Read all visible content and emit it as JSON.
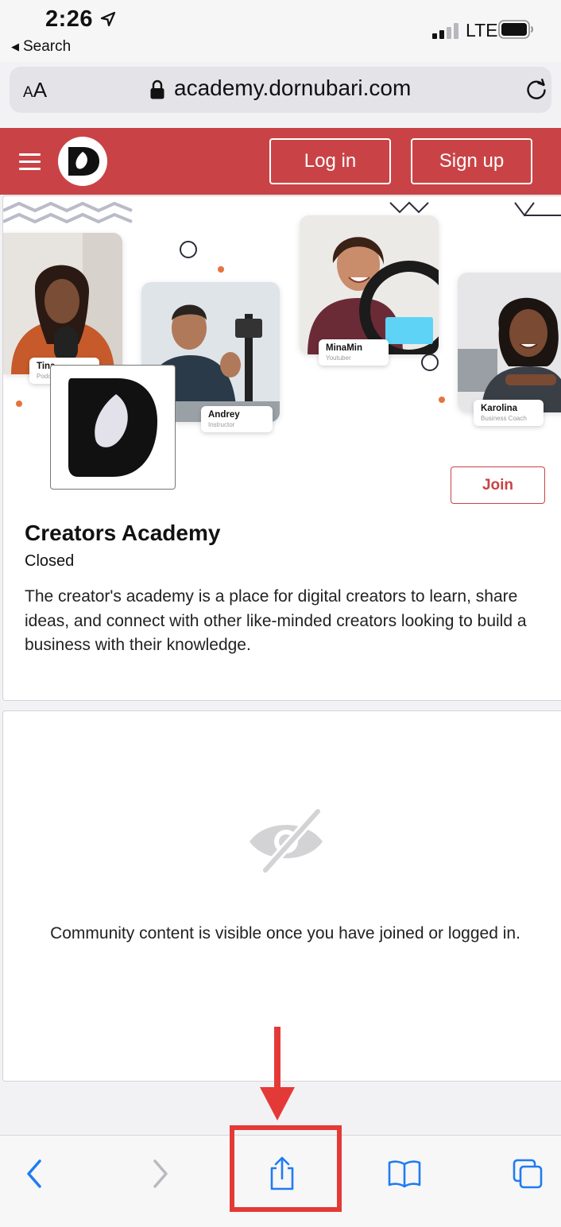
{
  "status_bar": {
    "time": "2:26",
    "back_label": "Search",
    "network": "LTE"
  },
  "address_bar": {
    "text_size_label": "AA",
    "url": "academy.dornubari.com"
  },
  "site_header": {
    "login_label": "Log in",
    "signup_label": "Sign up",
    "accent_color": "#c94346"
  },
  "banner": {
    "people": [
      {
        "name": "Tina",
        "role": "Podcaster"
      },
      {
        "name": "Andrey",
        "role": "Instructor"
      },
      {
        "name": "MinaMin",
        "role": "Youtuber"
      },
      {
        "name": "Karolina",
        "role": "Business Coach"
      }
    ]
  },
  "community": {
    "join_label": "Join",
    "title": "Creators Academy",
    "status": "Closed",
    "description": "The creator's academy is a place for digital creators to learn, share ideas, and connect with other like-minded creators looking to build a business with their knowledge."
  },
  "locked_content": {
    "icon": "eye-slash-icon",
    "message": "Community content is visible once you have joined or logged in."
  },
  "toolbar": {
    "items": [
      "back-icon",
      "forward-icon",
      "share-icon",
      "bookmarks-icon",
      "tabs-icon"
    ],
    "tint_color": "#1f7cf2"
  },
  "annotation": {
    "color": "#e43a37",
    "target": "share-button"
  }
}
